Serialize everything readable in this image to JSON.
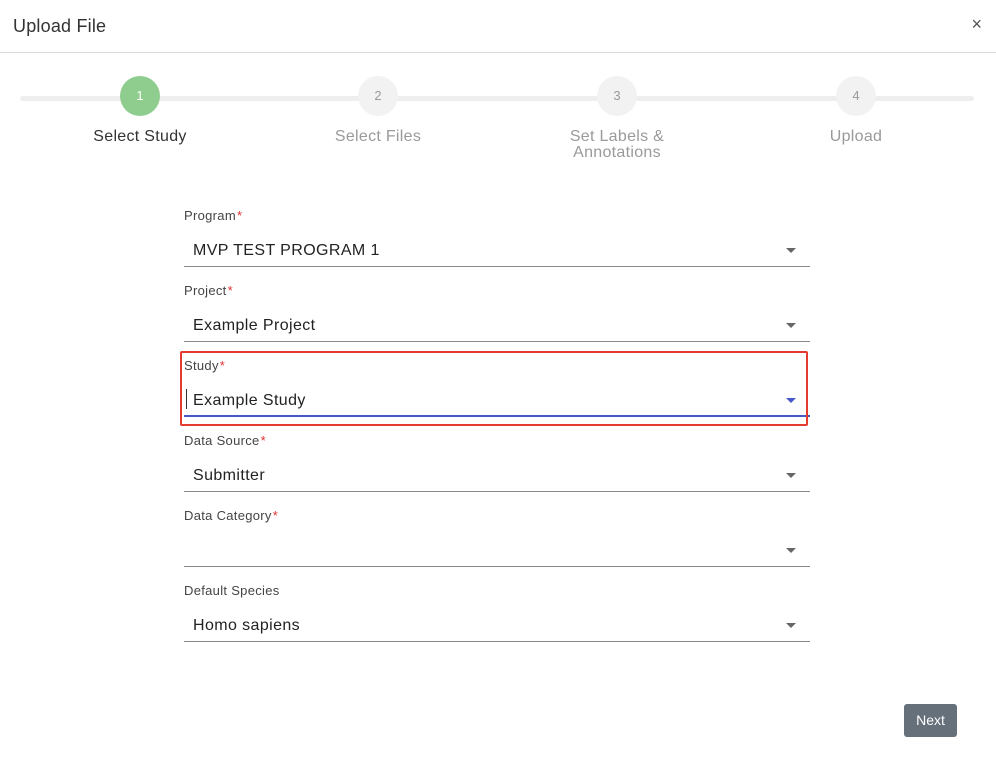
{
  "dialog": {
    "title": "Upload File",
    "close_label": "×"
  },
  "stepper": {
    "steps": [
      {
        "number": "1",
        "label": "Select Study",
        "active": true
      },
      {
        "number": "2",
        "label": "Select Files",
        "active": false
      },
      {
        "number": "3",
        "label_line1": "Set Labels &",
        "label_line2": "Annotations",
        "active": false
      },
      {
        "number": "4",
        "label": "Upload",
        "active": false
      }
    ]
  },
  "form": {
    "program": {
      "label": "Program",
      "required_mark": "*",
      "value": "MVP TEST PROGRAM 1"
    },
    "project": {
      "label": "Project",
      "required_mark": "*",
      "value": "Example Project"
    },
    "study": {
      "label": "Study",
      "required_mark": "*",
      "value": "Example Study"
    },
    "data_source": {
      "label": "Data Source",
      "required_mark": "*",
      "value": "Submitter"
    },
    "data_category": {
      "label": "Data Category",
      "required_mark": "*",
      "value": ""
    },
    "default_species": {
      "label": "Default Species",
      "value": "Homo sapiens"
    }
  },
  "footer": {
    "next_label": "Next"
  },
  "colors": {
    "accent_focus": "#4759c6",
    "step_active": "#8fcd8f",
    "highlight": "#e53a2f",
    "required": "#e03030"
  }
}
